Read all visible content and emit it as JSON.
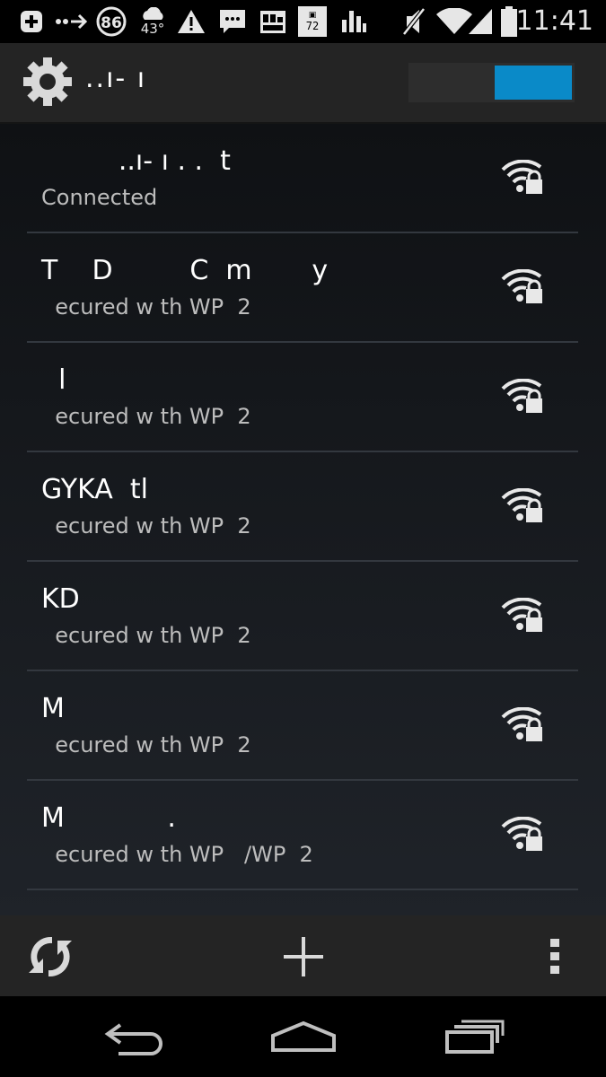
{
  "status_bar": {
    "badge_number": "86",
    "temperature": "43°",
    "calendar_day": "72",
    "time": "11:41"
  },
  "action_bar": {
    "title": "..ı- ı",
    "wifi_enabled": true
  },
  "networks": [
    {
      "name": "         ..ı- ı . .  t",
      "status": "Connected"
    },
    {
      "name": "T    D         C  m       y",
      "status": "  ecured w th WP  2"
    },
    {
      "name": "  l",
      "status": "  ecured w th WP  2"
    },
    {
      "name": "GYKA  tl",
      "status": "  ecured w th WP  2"
    },
    {
      "name": "KD",
      "status": "  ecured w th WP  2"
    },
    {
      "name": "M",
      "status": "  ecured w th WP  2"
    },
    {
      "name": "M            .",
      "status": "  ecured w th WP   /WP  2"
    }
  ],
  "colors": {
    "accent": "#0a8ac8",
    "action_bar": "#242424",
    "divider": "#33383f"
  },
  "icons": {
    "status": [
      "add-notification-icon",
      "usb-debug-icon",
      "badge-icon",
      "weather-icon",
      "warning-icon",
      "chat-icon",
      "gallery-icon",
      "calendar-icon",
      "bars-icon",
      "mute-icon",
      "wifi-icon",
      "cell-signal-icon",
      "battery-icon"
    ],
    "list": "wifi-locked-icon",
    "bottom": [
      "refresh-icon",
      "add-icon",
      "overflow-icon"
    ],
    "nav": [
      "back-icon",
      "home-icon",
      "recents-icon"
    ]
  }
}
